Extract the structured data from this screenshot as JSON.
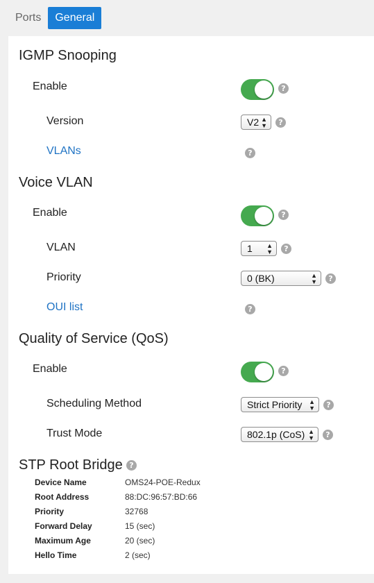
{
  "tabs": [
    {
      "label": "Ports",
      "active": false
    },
    {
      "label": "General",
      "active": true
    }
  ],
  "accent_color": "#1a7ed6",
  "toggle_on_color": "#45a94f",
  "igmp": {
    "title": "IGMP Snooping",
    "enable_label": "Enable",
    "enabled": true,
    "version_label": "Version",
    "version_value": "V2",
    "vlans_link": "VLANs"
  },
  "voice_vlan": {
    "title": "Voice VLAN",
    "enable_label": "Enable",
    "enabled": true,
    "vlan_label": "VLAN",
    "vlan_value": "1",
    "priority_label": "Priority",
    "priority_value": "0 (BK)",
    "oui_link": "OUI list"
  },
  "qos": {
    "title": "Quality of Service (QoS)",
    "enable_label": "Enable",
    "enabled": true,
    "scheduling_label": "Scheduling Method",
    "scheduling_value": "Strict Priority",
    "trust_label": "Trust Mode",
    "trust_value": "802.1p (CoS)"
  },
  "stp": {
    "title": "STP Root Bridge",
    "rows": [
      {
        "label": "Device Name",
        "value": "OMS24-POE-Redux"
      },
      {
        "label": "Root Address",
        "value": "88:DC:96:57:BD:66"
      },
      {
        "label": "Priority",
        "value": "32768"
      },
      {
        "label": "Forward Delay",
        "value": "15 (sec)"
      },
      {
        "label": "Maximum Age",
        "value": "20 (sec)"
      },
      {
        "label": "Hello Time",
        "value": "2 (sec)"
      }
    ]
  },
  "help_glyph": "?",
  "select_arrows": {
    "up": "▲",
    "down": "▼"
  }
}
